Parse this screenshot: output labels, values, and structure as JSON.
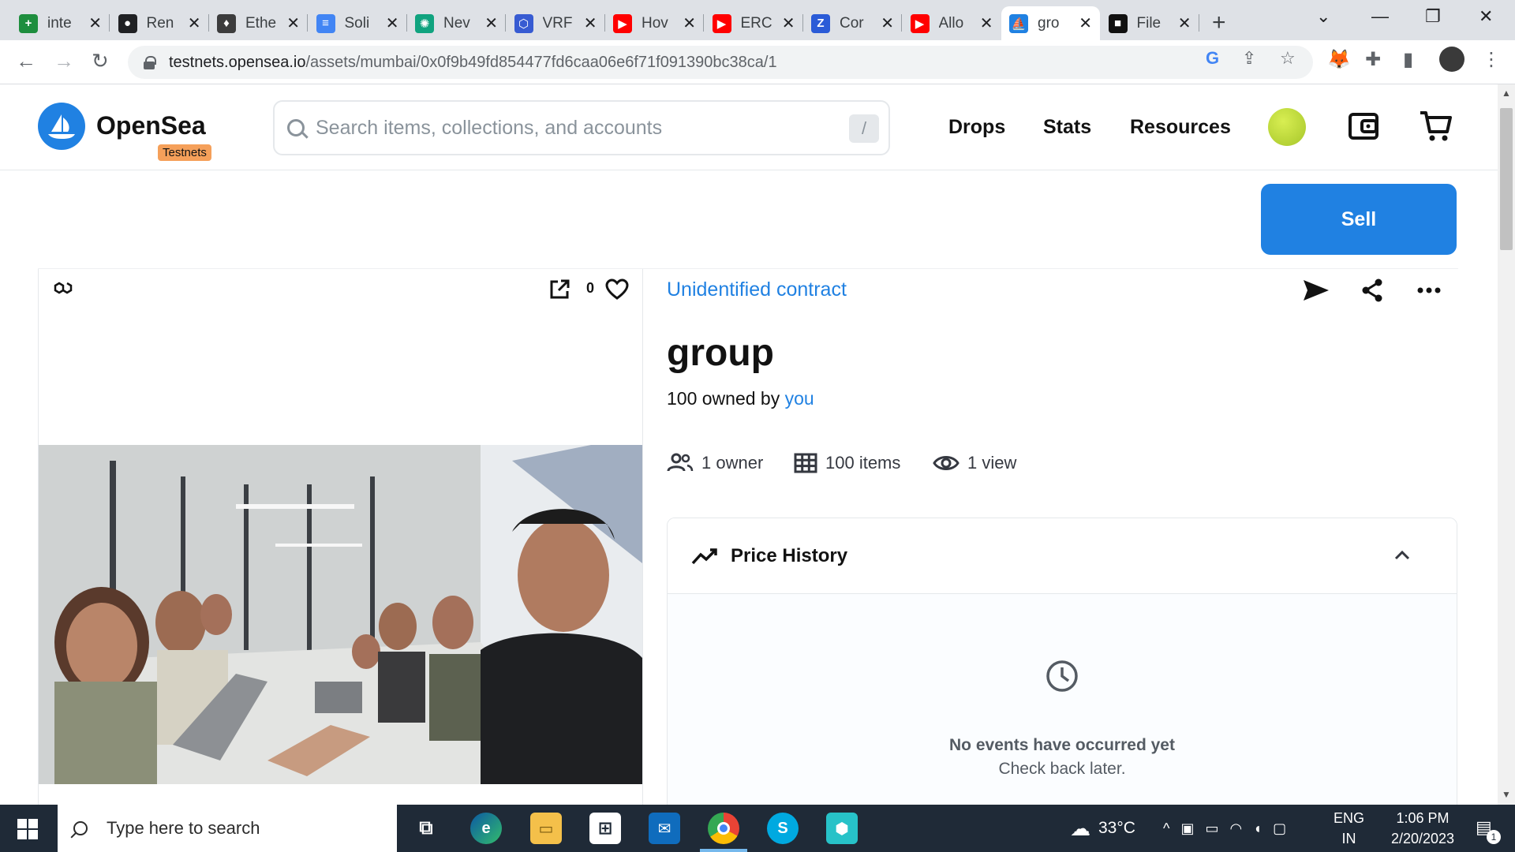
{
  "browser": {
    "tabs": [
      {
        "title": "inte",
        "color": "#1e8e3e",
        "glyph": "+"
      },
      {
        "title": "Ren",
        "color": "#202124",
        "glyph": "●"
      },
      {
        "title": "Ethe",
        "color": "#3c3c3d",
        "glyph": "♦"
      },
      {
        "title": "Soli",
        "color": "#4285f4",
        "glyph": "≡"
      },
      {
        "title": "Nev",
        "color": "#10a37f",
        "glyph": "✺"
      },
      {
        "title": "VRF",
        "color": "#375bd2",
        "glyph": "⬡"
      },
      {
        "title": "Hov",
        "color": "#ff0000",
        "glyph": "▶"
      },
      {
        "title": "ERC",
        "color": "#ff0000",
        "glyph": "▶"
      },
      {
        "title": "Cor",
        "color": "#2a5bd7",
        "glyph": "Z"
      },
      {
        "title": "Allo",
        "color": "#ff0000",
        "glyph": "▶"
      },
      {
        "title": "gro",
        "color": "#2081e2",
        "glyph": "⛵"
      },
      {
        "title": "File",
        "color": "#111111",
        "glyph": "■"
      }
    ],
    "active_tab": 10,
    "url_host": "testnets.opensea.io",
    "url_path": "/assets/mumbai/0x0f9b49fd854477fd6caa06e6f71f091390bc38ca/1"
  },
  "header": {
    "logo": "OpenSea",
    "badge": "Testnets",
    "search_placeholder": "Search items, collections, and accounts",
    "search_shortcut": "/",
    "nav": [
      "Drops",
      "Stats",
      "Resources"
    ]
  },
  "sell_label": "Sell",
  "media": {
    "favorites": "0"
  },
  "asset": {
    "contract": "Unidentified contract",
    "title": "group",
    "owned_prefix": "100 owned by ",
    "owned_by": "you",
    "owners": "1 owner",
    "items": "100 items",
    "views": "1 view"
  },
  "price_history": {
    "title": "Price History",
    "empty": "No events have occurred yet",
    "sub": "Check back later."
  },
  "taskbar": {
    "search_placeholder": "Type here to search",
    "weather": "33°C",
    "lang_top": "ENG",
    "lang_bottom": "IN",
    "time": "1:06 PM",
    "date": "2/20/2023",
    "notif_count": "1"
  },
  "colors": {
    "brand": "#2081e2",
    "badge": "#f5a05a",
    "taskbar": "#1f2a37"
  }
}
